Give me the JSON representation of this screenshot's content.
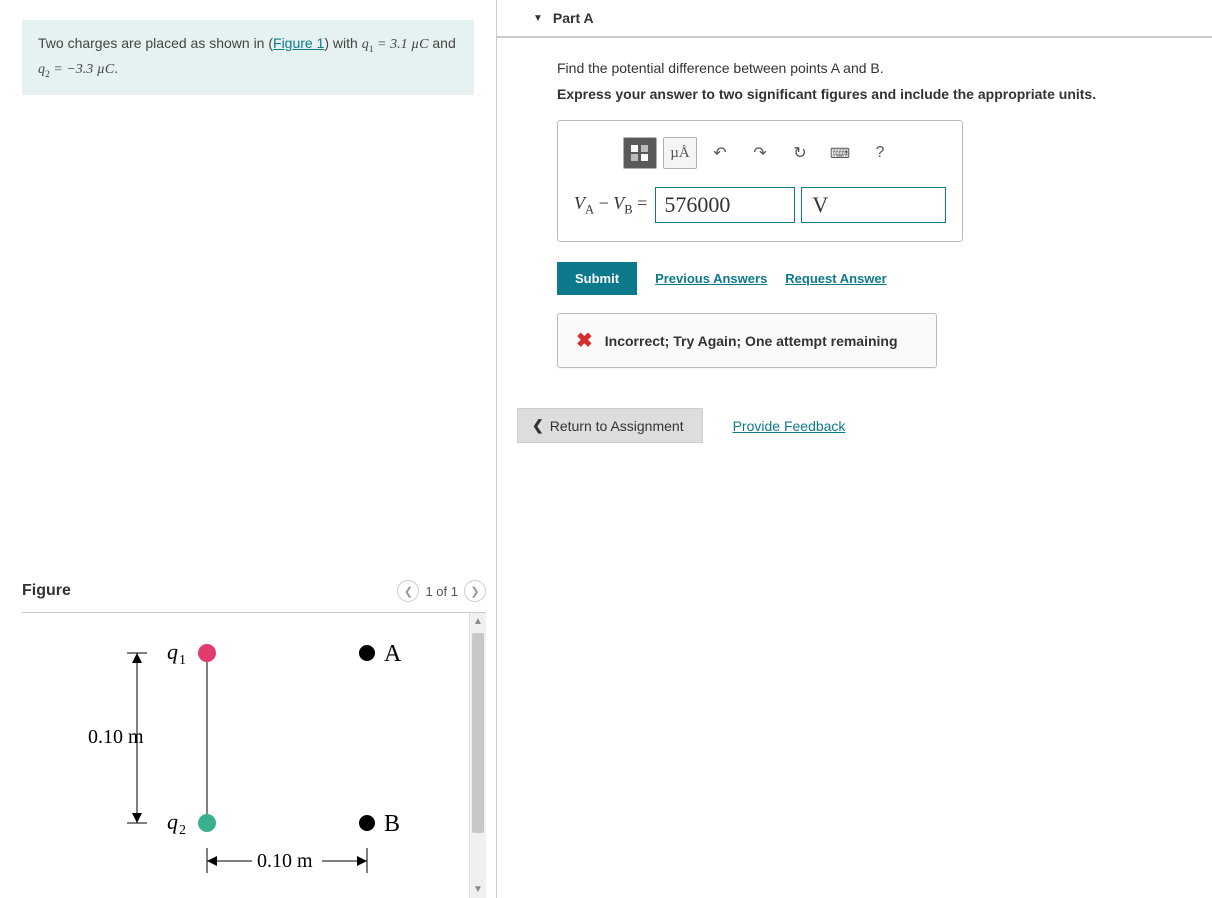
{
  "problem": {
    "text_prefix": "Two charges are placed as shown in (",
    "figure_link": "Figure 1",
    "text_middle": ") with ",
    "q1_expr": "q₁ = 3.1 µC",
    "text_and": " and ",
    "q2_expr": "q₂ = −3.3 µC",
    "text_suffix": "."
  },
  "figure": {
    "heading": "Figure",
    "nav_label": "1 of 1",
    "labels": {
      "q1": "q₁",
      "q2": "q₂",
      "A": "A",
      "B": "B",
      "d_vert": "0.10 m",
      "d_horiz": "0.10 m"
    }
  },
  "part": {
    "title": "Part A",
    "instruction": "Find the potential difference between points A and B.",
    "instruction_bold": "Express your answer to two significant figures and include the appropriate units.",
    "toolbar": {
      "units_btn": "µÅ",
      "help_btn": "?"
    },
    "answer": {
      "lhs_html": "VA − VB =",
      "value": "576000",
      "unit": "V"
    },
    "submit_label": "Submit",
    "prev_answers_label": "Previous Answers",
    "request_answer_label": "Request Answer",
    "feedback": "Incorrect; Try Again; One attempt remaining"
  },
  "footer": {
    "return_label": "Return to Assignment",
    "feedback_link": "Provide Feedback"
  }
}
